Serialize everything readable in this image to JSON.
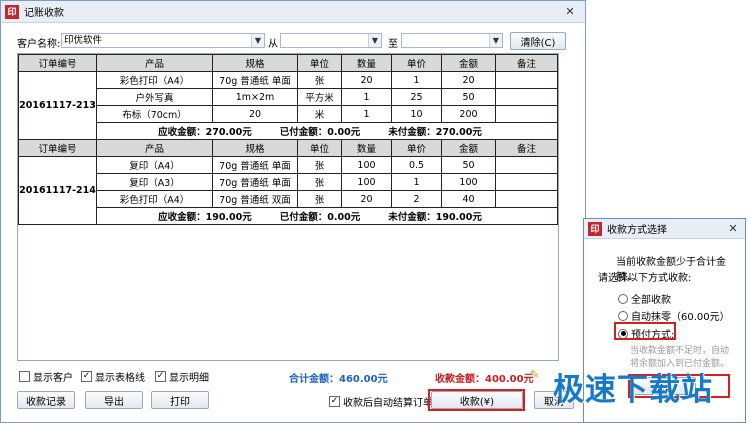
{
  "window": {
    "title": "记账收款",
    "icon_text": "印",
    "close": "✕"
  },
  "filter": {
    "customer_label": "客户名称:",
    "customer_value": "印优软件",
    "from_label": "从",
    "to_label": "至",
    "clear_button": "清除(C)"
  },
  "table": {
    "headers": [
      "订单编号",
      "产品",
      "规格",
      "单位",
      "数量",
      "单价",
      "金额",
      "备注"
    ],
    "orders": [
      {
        "id": "20161117-213",
        "rows": [
          [
            "彩色打印（A4）",
            "70g 普通纸 单面",
            "张",
            "20",
            "1",
            "20",
            ""
          ],
          [
            "户外写真",
            "1m×2m",
            "平方米",
            "1",
            "25",
            "50",
            ""
          ],
          [
            "布标（70cm）",
            "20",
            "米",
            "1",
            "10",
            "200",
            ""
          ]
        ],
        "summary": {
          "receivable": "应收金额：270.00元",
          "paid": "已付金额：0.00元",
          "unpaid": "未付金额：270.00元"
        }
      },
      {
        "id": "20161117-214",
        "rows": [
          [
            "复印（A4）",
            "70g 普通纸 单面",
            "张",
            "100",
            "0.5",
            "50",
            ""
          ],
          [
            "复印（A3）",
            "70g 普通纸 单面",
            "张",
            "100",
            "1",
            "100",
            ""
          ],
          [
            "彩色打印（A4）",
            "70g 普通纸 双面",
            "张",
            "20",
            "2",
            "40",
            ""
          ]
        ],
        "summary": {
          "receivable": "应收金额：190.00元",
          "paid": "已付金额：0.00元",
          "unpaid": "未付金额：190.00元"
        }
      }
    ]
  },
  "options": {
    "show_customer": "显示客户",
    "show_grid": "显示表格线",
    "show_detail": "显示明细",
    "total_label": "合计金额：460.00元",
    "receive_label": "收款金额：400.00元"
  },
  "buttons": {
    "records": "收款记录",
    "export": "导出",
    "print": "打印",
    "auto_settle": "收款后自动结算订单",
    "receive": "收款(¥)",
    "cancel": "取消"
  },
  "dialog": {
    "title": "收款方式选择",
    "icon_text": "印",
    "close": "✕",
    "line1": "当前收款金额少于合计金额，",
    "line2": "请选择以下方式收款:",
    "opt_all": "全部收款",
    "opt_auto": "自动抹零（60.00元）",
    "opt_prepay": "预付方式:",
    "note1": "当收款金额不足时，自动",
    "note2": "将余额加入到已付金额。",
    "ok_partial": "确认"
  },
  "watermark": "极速下载站",
  "colors": {
    "total": "#1a62c6",
    "receive": "#c81e1e",
    "highlight": "#d42020",
    "watermark": "#1679c9"
  }
}
